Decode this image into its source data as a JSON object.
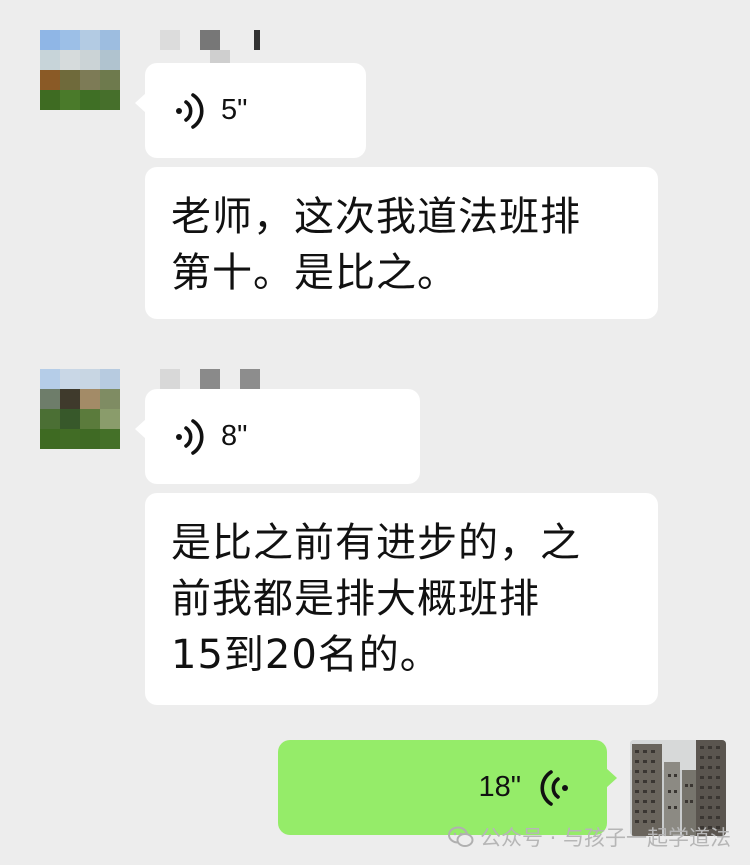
{
  "messages": [
    {
      "sender": "other",
      "type": "voice",
      "duration": "5\""
    },
    {
      "sender": "other",
      "type": "text",
      "text": "老师，这次我道法班排\n第十。是比之。"
    },
    {
      "sender": "other",
      "type": "voice",
      "duration": "8\""
    },
    {
      "sender": "other",
      "type": "text",
      "text": "是比之前有进步的，之\n前我都是排大概班排\n15到20名的。"
    },
    {
      "sender": "me",
      "type": "voice",
      "duration": "18\""
    }
  ],
  "icons": {
    "voice_incoming": "voice-wave-icon",
    "voice_outgoing": "voice-wave-icon",
    "watermark": "wechat-official-account-icon"
  },
  "colors": {
    "background": "#ededed",
    "incoming_bubble": "#ffffff",
    "outgoing_bubble": "#95ec69"
  },
  "watermark": {
    "text": "公众号 · 与孩子一起学道法"
  }
}
